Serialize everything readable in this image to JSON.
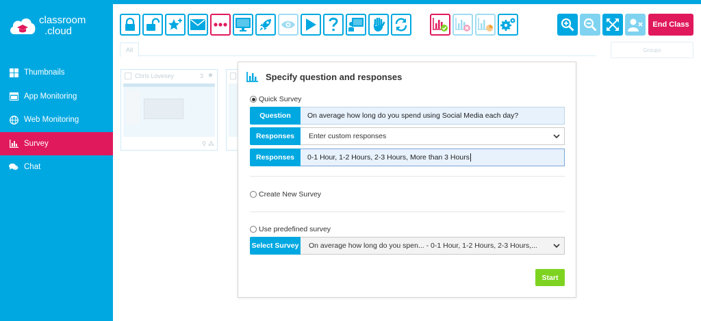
{
  "app": {
    "logo_line1": "classroom",
    "logo_line2": ".cloud"
  },
  "sidebar": {
    "items": [
      {
        "label": "Thumbnails",
        "icon": "grid-icon"
      },
      {
        "label": "App Monitoring",
        "icon": "window-icon"
      },
      {
        "label": "Web Monitoring",
        "icon": "globe-icon"
      },
      {
        "label": "Survey",
        "icon": "bar-chart-icon",
        "active": true
      },
      {
        "label": "Chat",
        "icon": "chat-bubbles-icon"
      }
    ]
  },
  "toolbar": {
    "end_class_label": "End Class",
    "colors": {
      "accent": "#00a8e1",
      "danger": "#e0195c",
      "success": "#7ed321"
    }
  },
  "tabs": {
    "all_label": "All",
    "groups_label": "Groups"
  },
  "thumbnails": [
    {
      "name": "Chris Lovesey",
      "count": "3"
    },
    {
      "name": "",
      "count": ""
    }
  ],
  "dialog": {
    "title": "Specify question and responses",
    "quick_survey_label": "Quick Survey",
    "question_label": "Question",
    "question_value": "On average how long do you spend using Social Media each day?",
    "responses_label": "Responses",
    "responses_select_value": "Enter custom responses",
    "responses_custom_value": "0-1 Hour, 1-2 Hours, 2-3 Hours, More than 3 Hours",
    "create_new_label": "Create New Survey",
    "predefined_label": "Use predefined survey",
    "select_survey_label": "Select Survey",
    "select_survey_value": "On average how long do you spen... - 0-1 Hour, 1-2 Hours, 2-3 Hours,...",
    "start_label": "Start"
  }
}
